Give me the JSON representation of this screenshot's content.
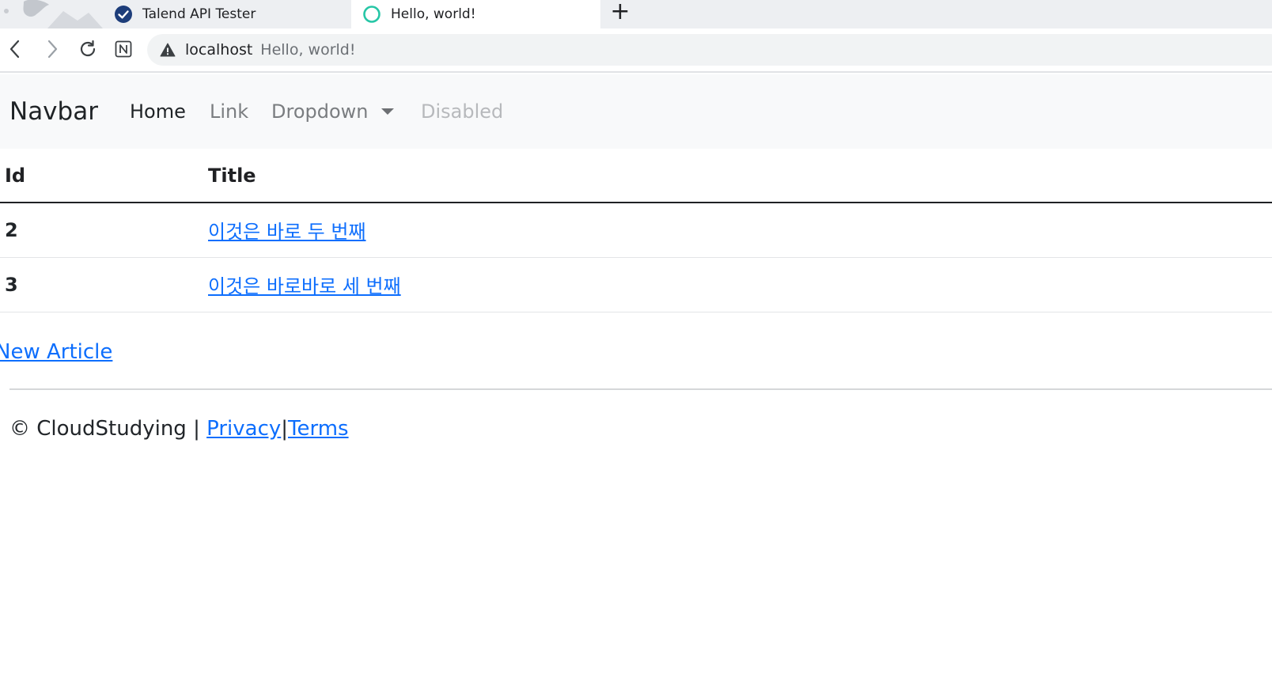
{
  "browser": {
    "tabs": [
      {
        "label": "Talend API Tester",
        "icon": "talend-check-icon",
        "active": false
      },
      {
        "label": "Hello, world!",
        "icon": "loading-circle-icon",
        "active": true
      }
    ],
    "new_tab_label": "+",
    "address": {
      "host": "localhost",
      "title": "Hello, world!"
    }
  },
  "navbar": {
    "brand": "Navbar",
    "items": [
      {
        "label": "Home",
        "state": "active"
      },
      {
        "label": "Link",
        "state": "normal"
      },
      {
        "label": "Dropdown",
        "state": "dropdown"
      },
      {
        "label": "Disabled",
        "state": "disabled"
      }
    ]
  },
  "table": {
    "headers": [
      "Id",
      "Title"
    ],
    "rows": [
      {
        "id": "2",
        "title": "이것은 바로 두 번째"
      },
      {
        "id": "3",
        "title": "이것은 바로바로 세 번째"
      }
    ]
  },
  "new_article_label": "New Article",
  "footer": {
    "copyright": "© CloudStudying | ",
    "privacy": "Privacy",
    "separator": "|",
    "terms": "Terms"
  },
  "colors": {
    "link": "#0d6efd",
    "navbar_bg": "#f8f9fa",
    "tab_active_bg": "#ffffff",
    "tabstrip_bg": "#edeff2"
  }
}
